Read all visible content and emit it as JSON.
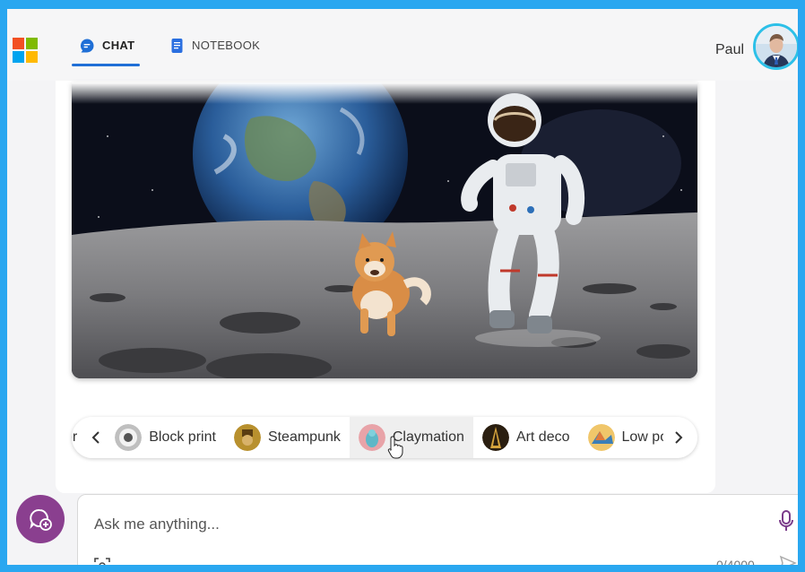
{
  "header": {
    "logo": "microsoft-logo",
    "tabs": [
      {
        "label": "CHAT",
        "icon": "chat-bubble-icon",
        "active": true
      },
      {
        "label": "NOTEBOOK",
        "icon": "notebook-icon",
        "active": false
      }
    ],
    "user_name": "Paul",
    "avatar": "user-avatar"
  },
  "image": {
    "subject": "astronaut-and-dog-on-moon"
  },
  "styles": {
    "items": [
      {
        "label": "or",
        "icon": "style-thumb"
      },
      {
        "label": "Block print",
        "icon": "block-print-thumb"
      },
      {
        "label": "Steampunk",
        "icon": "steampunk-thumb"
      },
      {
        "label": "Claymation",
        "icon": "claymation-thumb",
        "hovered": true
      },
      {
        "label": "Art deco",
        "icon": "art-deco-thumb"
      },
      {
        "label": "Low poly",
        "icon": "low-poly-thumb"
      }
    ],
    "prev_icon": "chevron-left-icon",
    "next_icon": "chevron-right-icon"
  },
  "composer": {
    "placeholder": "Ask me anything...",
    "counter": "0/4000",
    "new_topic_icon": "new-topic-icon",
    "mic_icon": "microphone-icon",
    "send_icon": "send-icon",
    "scan_icon": "image-scan-icon"
  },
  "colors": {
    "accent": "#1f6fd6",
    "new_topic": "#8a3f8f",
    "frame": "#2aa7f0"
  }
}
